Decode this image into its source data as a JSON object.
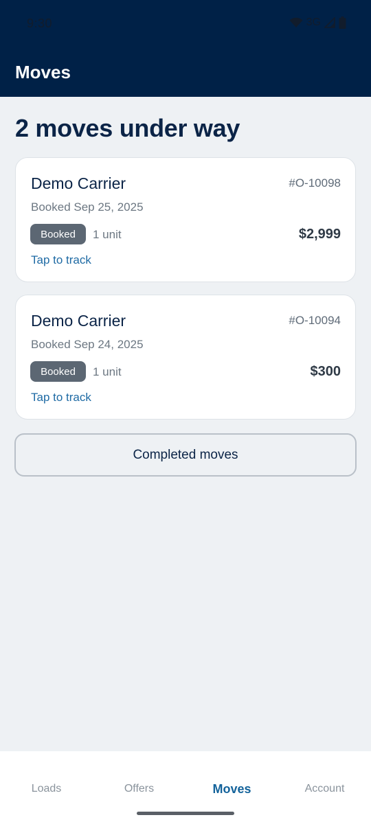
{
  "status_bar": {
    "time": "9:30",
    "network": "3G",
    "icons": [
      "wifi-icon",
      "signal-icon",
      "battery-icon"
    ]
  },
  "header": {
    "title": "Moves"
  },
  "main": {
    "heading": "2 moves under way",
    "moves": [
      {
        "carrier": "Demo Carrier",
        "id": "#O-10098",
        "booked_date": "Booked Sep 25, 2025",
        "status": "Booked",
        "units": "1 unit",
        "price": "$2,999",
        "track_label": "Tap to track"
      },
      {
        "carrier": "Demo Carrier",
        "id": "#O-10094",
        "booked_date": "Booked Sep 24, 2025",
        "status": "Booked",
        "units": "1 unit",
        "price": "$300",
        "track_label": "Tap to track"
      }
    ],
    "completed_button": "Completed moves"
  },
  "bottom_nav": {
    "items": [
      {
        "label": "Loads",
        "active": false
      },
      {
        "label": "Offers",
        "active": false
      },
      {
        "label": "Moves",
        "active": true
      },
      {
        "label": "Account",
        "active": false
      }
    ]
  },
  "colors": {
    "header_bg": "#002147",
    "page_bg": "#eef1f4",
    "accent": "#14639b",
    "badge_bg": "#5c6773",
    "title_text": "#0b2447"
  }
}
